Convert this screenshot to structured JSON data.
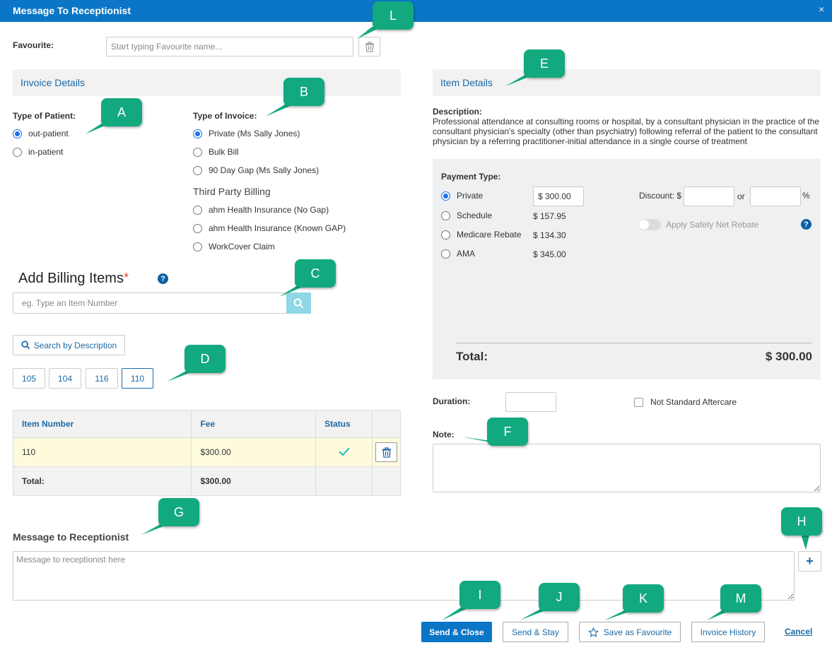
{
  "window": {
    "title": "Message To Receptionist",
    "close": "×"
  },
  "favourite": {
    "label": "Favourite:",
    "placeholder": "Start typing Favourite name..."
  },
  "invoice_details": {
    "header": "Invoice Details",
    "patient_label": "Type of Patient:",
    "patient_options": [
      "out-patient",
      "in-patient"
    ],
    "invoice_label": "Type of Invoice:",
    "invoice_options": [
      "Private (Ms Sally Jones)",
      "Bulk Bill",
      "90 Day Gap (Ms Sally Jones)"
    ],
    "third_party_label": "Third Party Billing",
    "third_party_options": [
      "ahm Health Insurance (No Gap)",
      "ahm Health Insurance (Known GAP)",
      "WorkCover Claim"
    ]
  },
  "billing": {
    "title": "Add Billing Items",
    "required": "*",
    "help": "?",
    "placeholder": "eg. Type an Item Number",
    "search_desc": "Search by Description",
    "quick_items": [
      "105",
      "104",
      "116",
      "110"
    ]
  },
  "table": {
    "headers": [
      "Item Number",
      "Fee",
      "Status"
    ],
    "row": {
      "item": "110",
      "fee": "$300.00"
    },
    "total_label": "Total:",
    "total_value": "$300.00"
  },
  "item_details": {
    "header": "Item Details",
    "desc_label": "Description:",
    "desc_text": "Professional attendance at consulting rooms or hospital, by a consultant physician in the practice of the consultant physician's specialty (other than psychiatry) following referral of the patient to the consultant physician by a referring practitioner-initial attendance in a single course of treatment"
  },
  "payment": {
    "label": "Payment Type:",
    "options": [
      {
        "label": "Private",
        "value": "$ 300.00"
      },
      {
        "label": "Schedule",
        "value": "$ 157.95"
      },
      {
        "label": "Medicare Rebate",
        "value": "$ 134.30"
      },
      {
        "label": "AMA",
        "value": "$ 345.00"
      }
    ],
    "discount_label": "Discount: $",
    "or": "or",
    "percent": "%",
    "safety_net": "Apply Safety Net Rebate",
    "help": "?",
    "total_label": "Total:",
    "total_value": "$ 300.00"
  },
  "duration": {
    "label": "Duration:"
  },
  "aftercare": {
    "label": "Not Standard Aftercare"
  },
  "note": {
    "label": "Note:"
  },
  "message": {
    "label": "Message to Receptionist",
    "placeholder": "Message to receptionist here",
    "add": "+"
  },
  "actions": {
    "send_close": "Send & Close",
    "send_stay": "Send & Stay",
    "save_fav": "Save as Favourite",
    "history": "Invoice History",
    "cancel": "Cancel"
  },
  "callouts": {
    "A": "A",
    "B": "B",
    "C": "C",
    "D": "D",
    "E": "E",
    "F": "F",
    "G": "G",
    "H": "H",
    "I": "I",
    "J": "J",
    "K": "K",
    "L": "L",
    "M": "M"
  },
  "colors": {
    "accent": "#0b76c6",
    "callout": "#13a97f",
    "highlight_row": "#fdfbdb"
  }
}
